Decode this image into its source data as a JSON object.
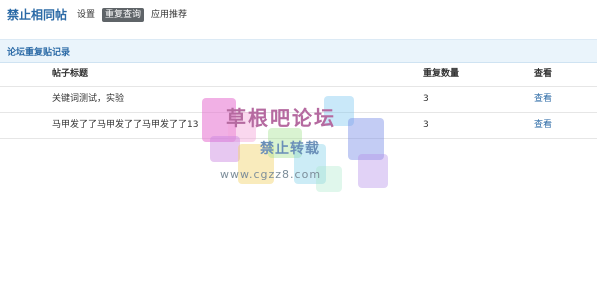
{
  "header": {
    "title": "禁止相同帖",
    "tabs": [
      {
        "label": "设置",
        "active": false
      },
      {
        "label": "重复查询",
        "active": true
      },
      {
        "label": "应用推荐",
        "active": false
      }
    ]
  },
  "section": {
    "title": "论坛重复贴记录"
  },
  "table": {
    "columns": [
      "帖子标题",
      "重复数量",
      "查看"
    ],
    "rows": [
      {
        "title": "关键词测试，实验",
        "count": "3",
        "action": "查看"
      },
      {
        "title": "马甲发了了马甲发了了马甲发了了13",
        "count": "3",
        "action": "查看"
      }
    ]
  },
  "watermark": {
    "name": "草根吧论坛",
    "subtitle": "禁止转载",
    "url": "www.cgzz8.com"
  },
  "colors": {
    "accent": "#2b6aa6",
    "active_tab_bg": "#5f6468",
    "section_bg": "#eaf4fb",
    "row_border": "#e6e6e6"
  }
}
